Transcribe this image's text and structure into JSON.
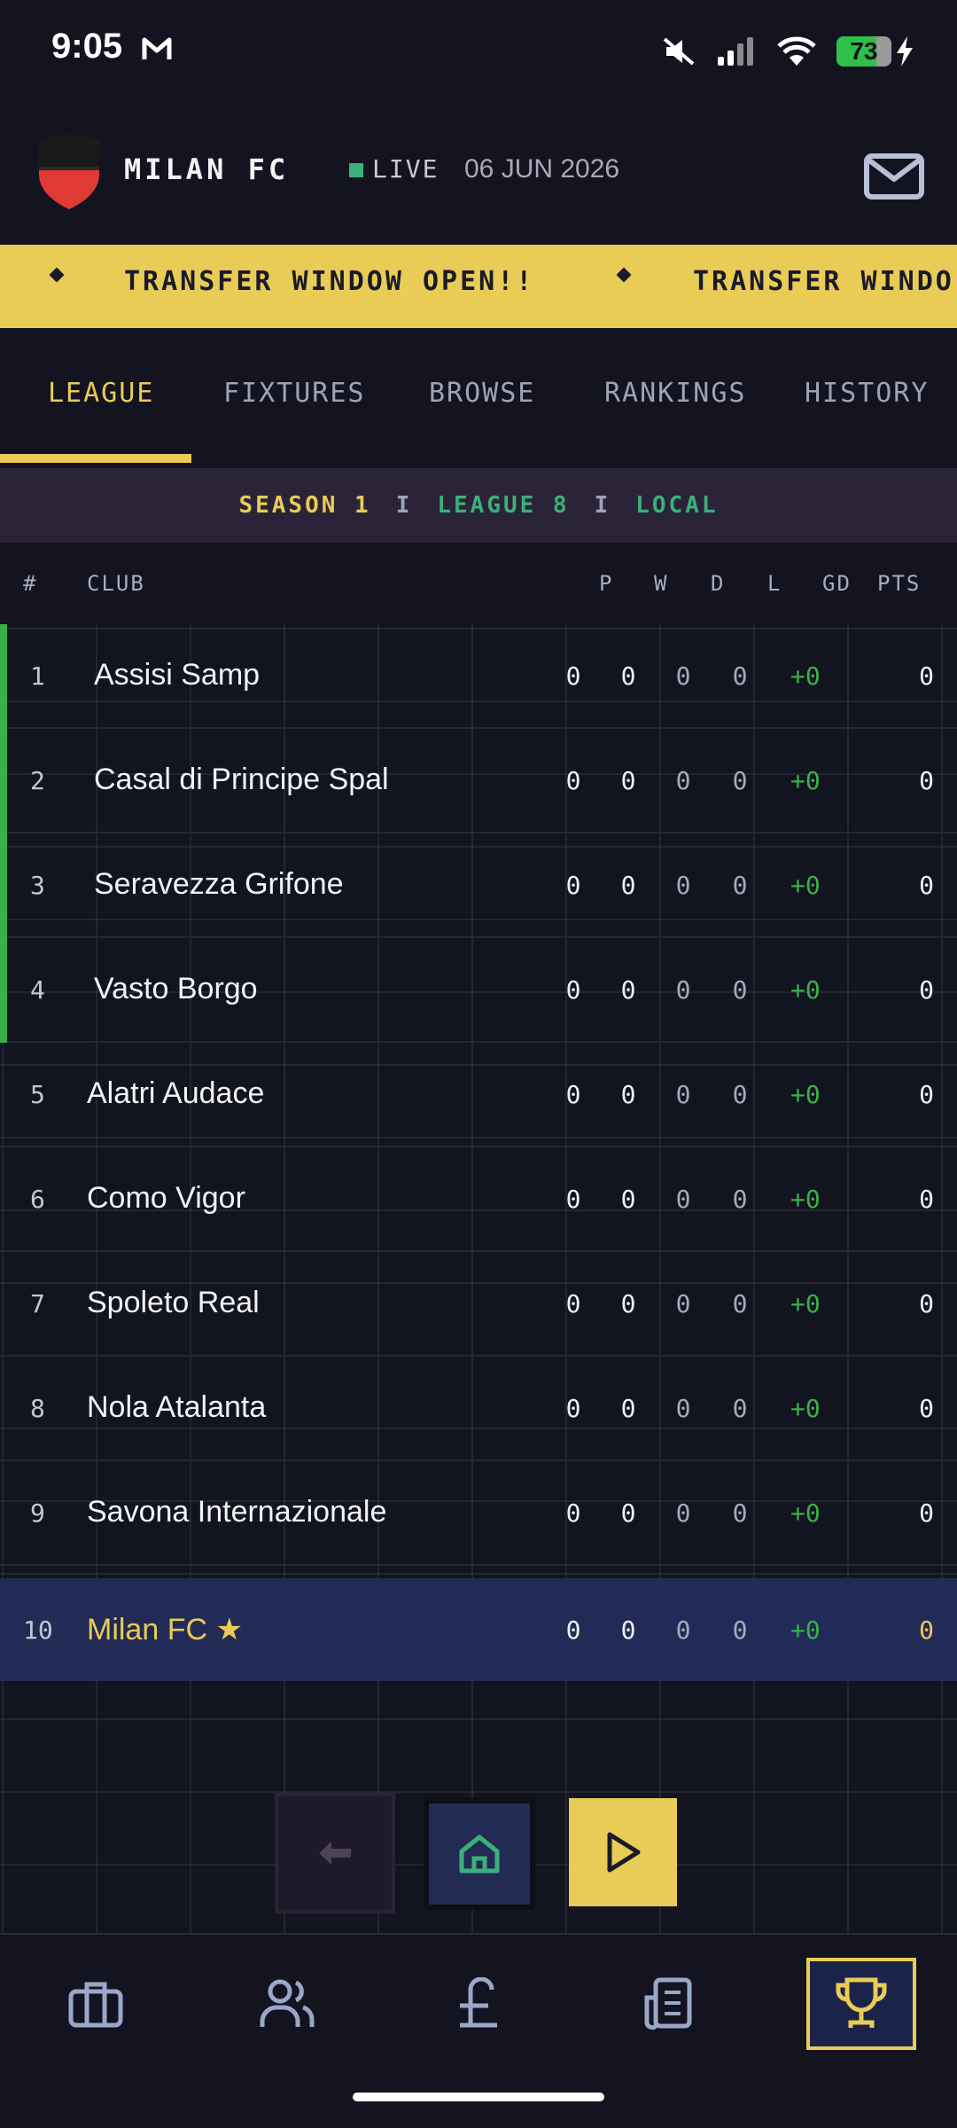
{
  "status_bar": {
    "time": "9:05",
    "battery": "73",
    "battery_level": 0.73
  },
  "header": {
    "club_name": "MILAN FC",
    "live_label": "LIVE",
    "date": "06 JUN 2026",
    "crest_colors": [
      "#1a1a1a",
      "#e03a35"
    ]
  },
  "ticker": {
    "items": [
      "TRANSFER WINDOW OPEN!!",
      "TRANSFER WINDO"
    ]
  },
  "tabs": [
    {
      "label": "LEAGUE",
      "active": true
    },
    {
      "label": "FIXTURES",
      "active": false
    },
    {
      "label": "BROWSE",
      "active": false
    },
    {
      "label": "RANKINGS",
      "active": false
    },
    {
      "label": "HISTORY",
      "active": false
    }
  ],
  "season_bar": {
    "season": "SEASON 1",
    "separator": "I",
    "league": "LEAGUE 8",
    "scope": "LOCAL"
  },
  "table": {
    "headers": {
      "pos": "#",
      "club": "CLUB",
      "p": "P",
      "w": "W",
      "d": "D",
      "l": "L",
      "gd": "GD",
      "pts": "PTS"
    },
    "rows": [
      {
        "pos": "1",
        "club": "Assisi Samp",
        "p": "0",
        "w": "0",
        "d": "0",
        "l": "0",
        "gd": "+0",
        "pts": "0",
        "promotion": true
      },
      {
        "pos": "2",
        "club": "Casal di Principe Spal",
        "p": "0",
        "w": "0",
        "d": "0",
        "l": "0",
        "gd": "+0",
        "pts": "0",
        "promotion": true
      },
      {
        "pos": "3",
        "club": "Seravezza Grifone",
        "p": "0",
        "w": "0",
        "d": "0",
        "l": "0",
        "gd": "+0",
        "pts": "0",
        "promotion": true
      },
      {
        "pos": "4",
        "club": "Vasto Borgo",
        "p": "0",
        "w": "0",
        "d": "0",
        "l": "0",
        "gd": "+0",
        "pts": "0",
        "promotion": true
      },
      {
        "pos": "5",
        "club": "Alatri Audace",
        "p": "0",
        "w": "0",
        "d": "0",
        "l": "0",
        "gd": "+0",
        "pts": "0"
      },
      {
        "pos": "6",
        "club": "Como Vigor",
        "p": "0",
        "w": "0",
        "d": "0",
        "l": "0",
        "gd": "+0",
        "pts": "0"
      },
      {
        "pos": "7",
        "club": "Spoleto Real",
        "p": "0",
        "w": "0",
        "d": "0",
        "l": "0",
        "gd": "+0",
        "pts": "0"
      },
      {
        "pos": "8",
        "club": "Nola Atalanta",
        "p": "0",
        "w": "0",
        "d": "0",
        "l": "0",
        "gd": "+0",
        "pts": "0"
      },
      {
        "pos": "9",
        "club": "Savona Internazionale",
        "p": "0",
        "w": "0",
        "d": "0",
        "l": "0",
        "gd": "+0",
        "pts": "0"
      },
      {
        "pos": "10",
        "club": "Milan FC ★",
        "p": "0",
        "w": "0",
        "d": "0",
        "l": "0",
        "gd": "+0",
        "pts": "0",
        "mine": true
      }
    ]
  },
  "floating_buttons": {
    "back": "arrow-left-icon",
    "home": "home-icon",
    "play": "play-icon"
  },
  "bottom_nav": [
    {
      "icon": "briefcase-icon",
      "active": false
    },
    {
      "icon": "users-icon",
      "active": false
    },
    {
      "icon": "pound-icon",
      "active": false
    },
    {
      "icon": "news-icon",
      "active": false
    },
    {
      "icon": "trophy-icon",
      "active": true
    }
  ],
  "colors": {
    "accent": "#e8cc56",
    "positive": "#3ab04a",
    "live": "#3ab07a",
    "highlight_row": "#222b55"
  }
}
